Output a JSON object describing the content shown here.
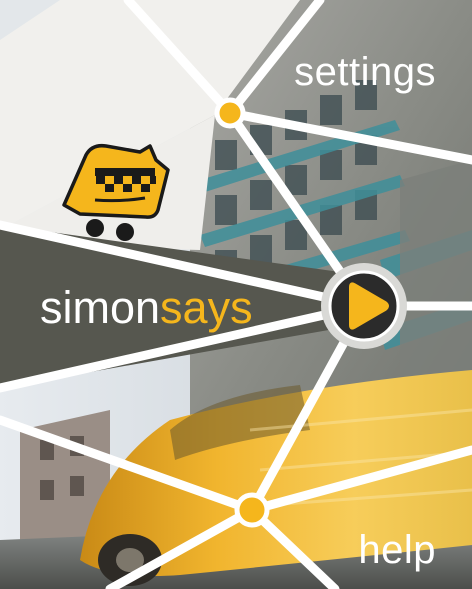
{
  "menu": {
    "settings_label": "settings",
    "help_label": "help",
    "brand_prefix": "simon",
    "brand_suffix": "says"
  },
  "icons": {
    "mascot": "taxi-mascot-icon",
    "play": "play-icon"
  },
  "colors": {
    "accent": "#f5b61c",
    "panel_dark": "#56574f",
    "panel_light": "#f1f0ed",
    "play_button": "#2b2b2b"
  }
}
